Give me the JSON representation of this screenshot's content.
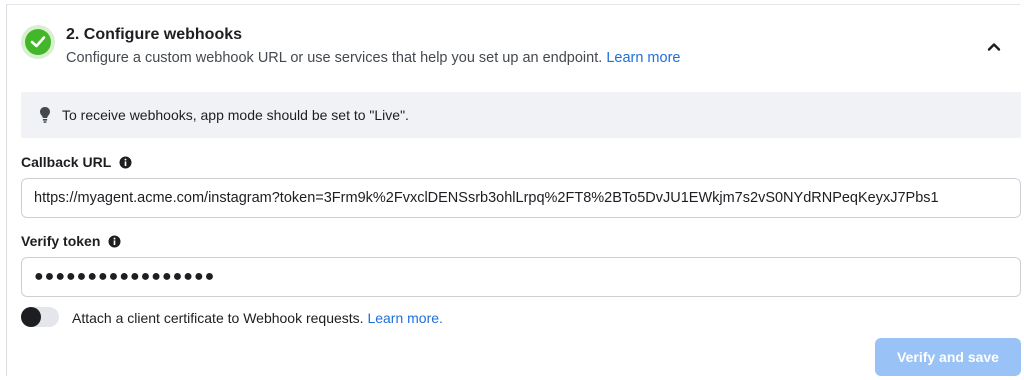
{
  "section": {
    "title": "2. Configure webhooks",
    "subtitle": "Configure a custom webhook URL or use services that help you set up an endpoint.",
    "learn_more": "Learn more",
    "status": "complete",
    "collapse_icon": "chevron-up-icon"
  },
  "notice": {
    "icon": "lightbulb-icon",
    "text": "To receive webhooks, app mode should be set to \"Live\"."
  },
  "callback_url": {
    "label": "Callback URL",
    "info_icon": "info-icon",
    "value": "https://myagent.acme.com/instagram?token=3Frm9k%2FvxclDENSsrb3ohlLrpq%2FT8%2BTo5DvJU1EWkjm7s2vS0NYdRNPeqKeyxJ7Pbs1"
  },
  "verify_token": {
    "label": "Verify token",
    "info_icon": "info-icon",
    "value": "●●●●●●●●●●●●●●●●●"
  },
  "client_certificate": {
    "label": "Attach a client certificate to Webhook requests.",
    "learn_more": "Learn more.",
    "enabled": false
  },
  "actions": {
    "verify_save": "Verify and save",
    "verify_save_enabled": false
  },
  "colors": {
    "accent_link": "#216fdb",
    "success": "#42b72a",
    "button_disabled": "#99c3f7",
    "notice_bg": "#f0f2f5"
  }
}
